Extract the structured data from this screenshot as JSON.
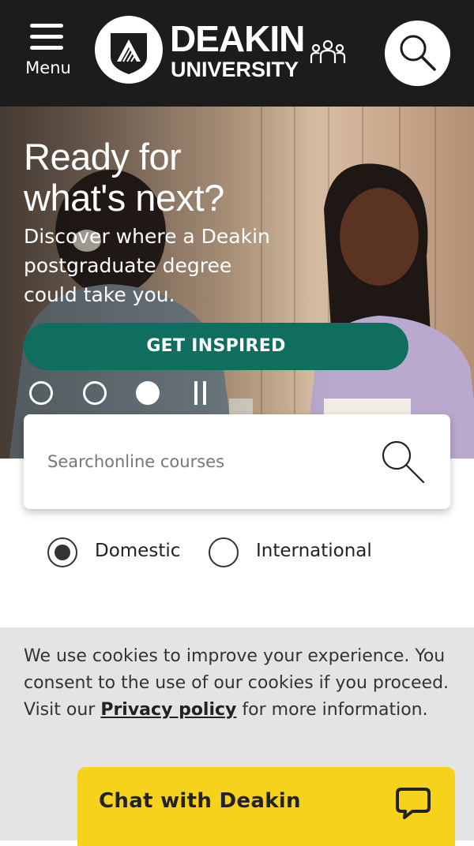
{
  "header": {
    "menu_label": "Menu",
    "logo_line1": "DEAKIN",
    "logo_line2": "UNIVERSITY"
  },
  "hero": {
    "title_line1": "Ready for",
    "title_line2": "what's next?",
    "subtitle": "Discover where a Deakin postgraduate degree could take you.",
    "cta_label": "GET INSPIRED",
    "carousel": {
      "slides": 3,
      "active_slide": 3
    }
  },
  "search": {
    "placeholder": "Searchonline courses"
  },
  "student_type": {
    "options": [
      {
        "label": "Domestic",
        "selected": true
      },
      {
        "label": "International",
        "selected": false
      }
    ]
  },
  "cookie_banner": {
    "text_before": "We use cookies to improve your experience. You consent to the use of our cookies if you proceed. Visit our ",
    "link_label": "Privacy policy",
    "text_after": " for more information."
  },
  "chat": {
    "label": "Chat with Deakin"
  },
  "colors": {
    "header_bg": "#1c1c1c",
    "cta_green": "#0f6e5d",
    "chat_yellow": "#f6d21d",
    "cookie_bg": "#e4e4e4"
  },
  "icons": {
    "menu": "hamburger-icon",
    "logo": "deakin-shield-logo",
    "people": "people-group-icon",
    "search": "magnifier-icon",
    "pause": "pause-icon",
    "chat": "speech-bubble-icon"
  }
}
